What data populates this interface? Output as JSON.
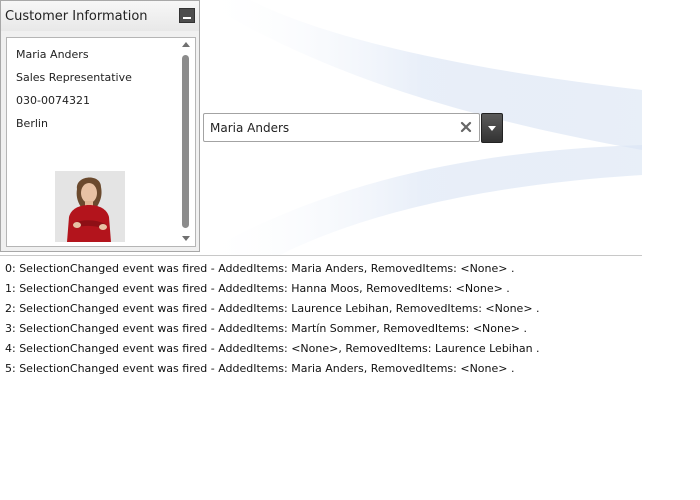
{
  "panel": {
    "title": "Customer Information",
    "contact_name": "Maria Anders",
    "contact_title": "Sales Representative",
    "phone": "030-0074321",
    "city": "Berlin"
  },
  "combobox": {
    "selected_text": "Maria Anders"
  },
  "event_log": [
    "0: SelectionChanged event was fired - AddedItems: Maria Anders, RemovedItems: <None> .",
    "1: SelectionChanged event was fired - AddedItems: Hanna Moos, RemovedItems: <None> .",
    "2: SelectionChanged event was fired - AddedItems: Laurence Lebihan, RemovedItems: <None> .",
    "3: SelectionChanged event was fired - AddedItems: Martín Sommer, RemovedItems: <None> .",
    "4: SelectionChanged event was fired - AddedItems: <None>, RemovedItems: Laurence Lebihan .",
    "5: SelectionChanged event was fired - AddedItems: Maria Anders, RemovedItems: <None> ."
  ],
  "icons": {
    "minimize": "minimize-icon",
    "clear": "clear-x-icon",
    "dropdown": "chevron-down-icon",
    "scroll_up": "arrow-up-icon",
    "scroll_down": "arrow-down-icon"
  },
  "colors": {
    "panel_bg": "#f0f0f0",
    "button_dark": "#4d4d4d",
    "swoosh": "#e8eef8"
  }
}
